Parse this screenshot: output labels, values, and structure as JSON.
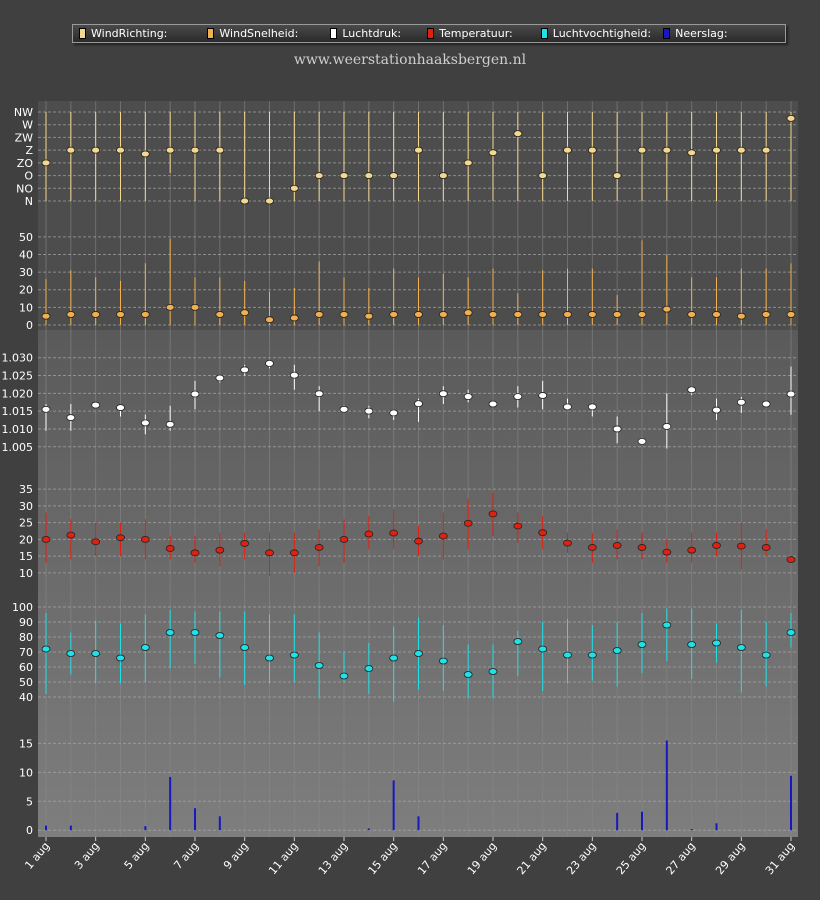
{
  "site_url": "www.weerstationhaaksbergen.nl",
  "legend": [
    {
      "label": "WindRichting:",
      "color": "#f5d890"
    },
    {
      "label": "WindSnelheid:",
      "color": "#f0b050"
    },
    {
      "label": "Luchtdruk:",
      "color": "#ffffff"
    },
    {
      "label": "Temperatuur:",
      "color": "#e02010"
    },
    {
      "label": "Luchtvochtigheid:",
      "color": "#20e0e8"
    },
    {
      "label": "Neerslag:",
      "color": "#1818c0"
    }
  ],
  "chart_data": {
    "type": "line",
    "x_tick_labels": [
      "1 aug",
      "3 aug",
      "5 aug",
      "7 aug",
      "9 aug",
      "11 aug",
      "13 aug",
      "15 aug",
      "17 aug",
      "19 aug",
      "21 aug",
      "23 aug",
      "25 aug",
      "27 aug",
      "29 aug",
      "31 aug"
    ],
    "x": [
      "1 aug",
      "2 aug",
      "3 aug",
      "4 aug",
      "5 aug",
      "6 aug",
      "7 aug",
      "8 aug",
      "9 aug",
      "10 aug",
      "11 aug",
      "12 aug",
      "13 aug",
      "14 aug",
      "15 aug",
      "16 aug",
      "17 aug",
      "18 aug",
      "19 aug",
      "20 aug",
      "21 aug",
      "22 aug",
      "23 aug",
      "24 aug",
      "25 aug",
      "26 aug",
      "27 aug",
      "28 aug",
      "29 aug",
      "30 aug",
      "31 aug"
    ],
    "panels": [
      {
        "name": "WindRichting",
        "type": "range-dot",
        "color": "#f5d890",
        "y_categories": [
          "N",
          "NO",
          "O",
          "ZO",
          "Z",
          "ZW",
          "W",
          "NW"
        ],
        "yticks": [
          "NW",
          "W",
          "ZW",
          "Z",
          "ZO",
          "O",
          "NO",
          "N"
        ],
        "values": [
          3,
          4,
          4,
          4,
          3.7,
          4,
          4,
          4,
          0,
          0,
          1,
          2,
          2,
          2,
          2,
          4,
          2,
          3,
          3.8,
          5.3,
          2,
          4,
          4,
          2,
          4,
          4,
          3.8,
          4,
          4,
          4,
          6.5
        ],
        "low": [
          0,
          0,
          0,
          0,
          0,
          2.2,
          0,
          0,
          0,
          0,
          0,
          0,
          0,
          0,
          0,
          0,
          0,
          0,
          0,
          0,
          0,
          0,
          0,
          0,
          0,
          0,
          0,
          0,
          0,
          0,
          0
        ],
        "high": [
          7,
          7,
          7,
          7,
          7,
          7,
          7,
          7,
          7,
          7,
          7,
          7,
          7,
          7,
          7,
          7,
          7,
          7,
          7,
          7,
          7,
          7,
          7,
          7,
          7,
          7,
          7,
          7,
          7,
          7,
          7
        ]
      },
      {
        "name": "WindSnelheid",
        "type": "range-dot",
        "color": "#f0b050",
        "ylim": [
          0,
          55
        ],
        "yticks": [
          0,
          10,
          20,
          30,
          40,
          50
        ],
        "values": [
          5,
          6,
          6,
          6,
          6,
          10,
          10,
          6,
          7,
          3,
          4,
          6,
          6,
          5,
          6,
          6,
          6,
          7,
          6,
          6,
          6,
          6,
          6,
          6,
          6,
          9,
          6,
          6,
          5,
          6,
          6
        ],
        "low": [
          0,
          0,
          0,
          0,
          0,
          0,
          0,
          0,
          0,
          0,
          0,
          0,
          0,
          0,
          0,
          0,
          0,
          0,
          0,
          0,
          0,
          0,
          0,
          0,
          0,
          0,
          0,
          0,
          0,
          0,
          0
        ],
        "high": [
          26,
          31,
          27,
          25,
          35,
          49,
          27,
          27,
          25,
          19,
          21,
          36,
          27,
          21,
          32,
          27,
          29,
          27,
          32,
          18,
          31,
          32,
          32,
          17,
          48,
          40,
          27,
          27,
          32,
          32,
          35
        ]
      },
      {
        "name": "Luchtdruk",
        "type": "range-dot",
        "color": "#ffffff",
        "ylim": [
          1.001,
          1.033
        ],
        "yticks": [
          "1.005",
          "1.010",
          "1.015",
          "1.020",
          "1.025",
          "1.030"
        ],
        "values": [
          1.0155,
          1.0132,
          1.0167,
          1.016,
          1.0117,
          1.0113,
          1.0198,
          1.0243,
          1.0266,
          1.0284,
          1.0251,
          1.0199,
          1.0155,
          1.015,
          1.0145,
          1.0171,
          1.0199,
          1.0191,
          1.017,
          1.0191,
          1.0194,
          1.0162,
          1.0162,
          1.01,
          1.0065,
          1.0107,
          1.021,
          1.0153,
          1.0175,
          1.017,
          1.0198
        ],
        "low": [
          1.0095,
          1.0095,
          1.0165,
          1.0135,
          1.0085,
          1.0095,
          1.0155,
          1.023,
          1.025,
          1.027,
          1.021,
          1.015,
          1.0145,
          1.013,
          1.0125,
          1.012,
          1.017,
          1.0175,
          1.0165,
          1.016,
          1.0155,
          1.0155,
          1.0135,
          1.006,
          1.0055,
          1.0045,
          1.0195,
          1.0125,
          1.0145,
          1.0165,
          1.014
        ],
        "high": [
          1.017,
          1.017,
          1.017,
          1.0165,
          1.014,
          1.0165,
          1.0235,
          1.025,
          1.028,
          1.029,
          1.028,
          1.022,
          1.0165,
          1.0165,
          1.0155,
          1.0185,
          1.022,
          1.021,
          1.0175,
          1.022,
          1.0235,
          1.0185,
          1.017,
          1.0135,
          1.0075,
          1.02,
          1.022,
          1.0185,
          1.019,
          1.0175,
          1.0275
        ]
      },
      {
        "name": "Temperatuur",
        "type": "range-dot",
        "color": "#e02010",
        "ylim": [
          7,
          38
        ],
        "yticks": [
          10,
          15,
          20,
          25,
          30,
          35
        ],
        "values": [
          20,
          21.3,
          19.3,
          20.5,
          20,
          17.3,
          16,
          16.8,
          18.8,
          16,
          16,
          17.6,
          20,
          21.6,
          21.9,
          19.5,
          21,
          24.8,
          27.6,
          24,
          22,
          18.9,
          17.6,
          18.2,
          17.6,
          16.2,
          16.8,
          18.2,
          18,
          17.6,
          14
        ],
        "low": [
          13,
          14,
          15,
          15,
          14,
          14,
          13,
          12,
          14,
          9,
          10,
          12,
          13,
          17,
          17,
          15,
          14,
          17,
          21,
          19,
          17,
          16,
          13,
          14,
          14,
          13,
          13,
          15,
          11,
          15,
          13
        ],
        "high": [
          28,
          26,
          25,
          25,
          26,
          21,
          21,
          22,
          22,
          22,
          22,
          23,
          26,
          27,
          29,
          24,
          28,
          32,
          34,
          28,
          27,
          22,
          22,
          23,
          22,
          20,
          22,
          22,
          25,
          23,
          15
        ]
      },
      {
        "name": "Luchtvochtigheid",
        "type": "range-dot",
        "color": "#20e0e8",
        "ylim": [
          30,
          102
        ],
        "yticks": [
          40,
          50,
          60,
          70,
          80,
          90,
          100
        ],
        "values": [
          72,
          69,
          69,
          66,
          73,
          83,
          83,
          81,
          73,
          66,
          68,
          61,
          54,
          59,
          66,
          69,
          64,
          55,
          57,
          77,
          72,
          68,
          68,
          71,
          75,
          88,
          75,
          76,
          73,
          68,
          83
        ],
        "low": [
          42,
          55,
          49,
          49,
          50,
          59,
          62,
          53,
          48,
          49,
          50,
          39,
          50,
          42,
          37,
          45,
          44,
          39,
          39,
          54,
          44,
          49,
          51,
          47,
          56,
          64,
          52,
          63,
          43,
          47,
          73
        ],
        "high": [
          96,
          83,
          91,
          89,
          95,
          98,
          97,
          97,
          97,
          95,
          95,
          83,
          70,
          76,
          87,
          93,
          88,
          75,
          75,
          84,
          90,
          92,
          88,
          90,
          96,
          99,
          99,
          89,
          98,
          90,
          96
        ]
      },
      {
        "name": "Neerslag",
        "type": "bar",
        "color": "#1818c0",
        "ylim": [
          -1,
          18
        ],
        "yticks": [
          0,
          5,
          10,
          15
        ],
        "values": [
          0.8,
          0.8,
          0,
          0,
          0.7,
          9.2,
          3.8,
          2.4,
          0,
          0,
          0,
          0,
          0,
          0.3,
          8.6,
          2.4,
          0,
          0,
          0,
          0,
          0,
          0,
          0,
          3,
          3.2,
          15.5,
          0.2,
          1.2,
          0,
          0,
          9.4
        ]
      }
    ]
  }
}
